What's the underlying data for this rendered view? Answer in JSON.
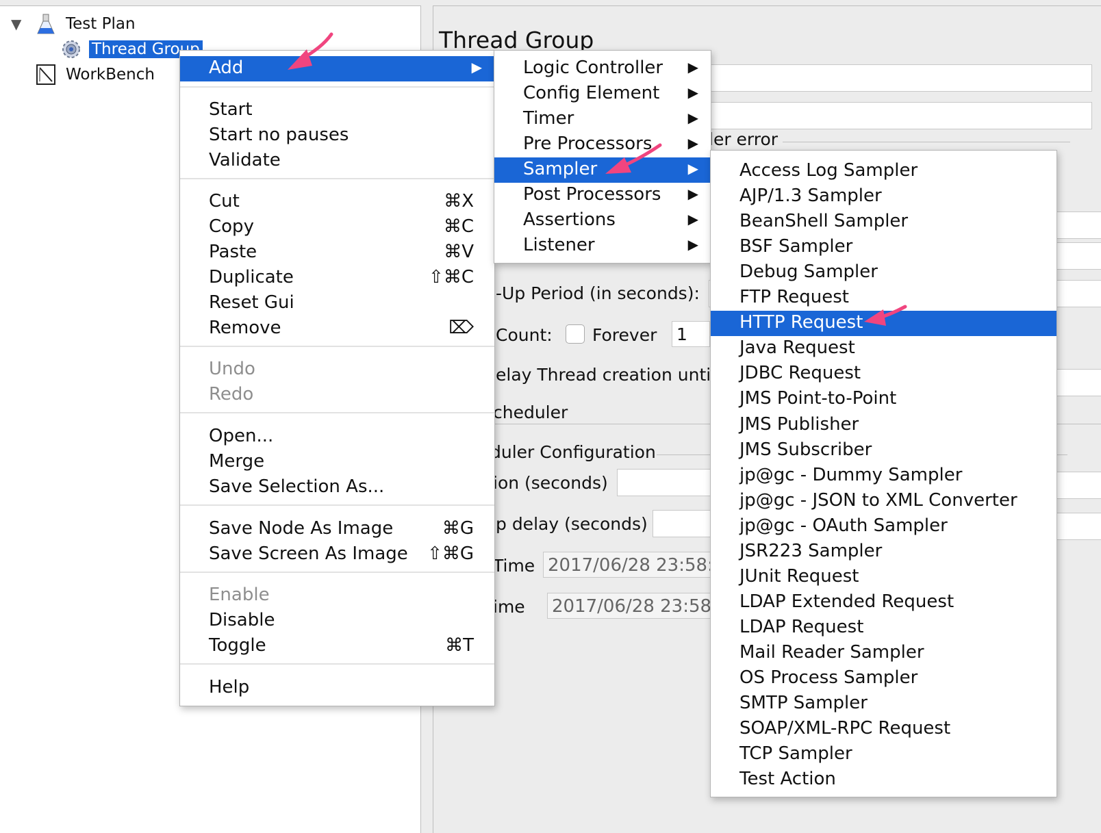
{
  "tree": {
    "items": [
      {
        "label": "Test Plan",
        "icon": "flask-icon"
      },
      {
        "label": "Thread Group",
        "icon": "gear-icon"
      },
      {
        "label": "WorkBench",
        "icon": "workbench-icon"
      }
    ]
  },
  "editor": {
    "title": "Thread Group",
    "fragments": {
      "sampler_error": "ler error",
      "rampup": "-Up Period (in seconds):",
      "loop_count": "Count:",
      "forever": "Forever",
      "loop_value": "1",
      "delay_thread": "elay Thread creation until",
      "scheduler": "cheduler",
      "scheduler_config": "duler Configuration",
      "duration": "ion (seconds)",
      "startup_delay": "p delay (seconds)",
      "start_time_label": "Time",
      "start_time_value": "2017/06/28 23:58:",
      "end_time_label": "ime",
      "end_time_value": "2017/06/28 23:58:"
    }
  },
  "context_menu": {
    "add": "Add",
    "start": "Start",
    "start_no_pauses": "Start no pauses",
    "validate": "Validate",
    "cut": "Cut",
    "cut_sc": "⌘X",
    "copy": "Copy",
    "copy_sc": "⌘C",
    "paste": "Paste",
    "paste_sc": "⌘V",
    "duplicate": "Duplicate",
    "duplicate_sc": "⇧⌘C",
    "reset_gui": "Reset Gui",
    "remove": "Remove",
    "remove_sc": "⌦",
    "undo": "Undo",
    "redo": "Redo",
    "open": "Open...",
    "merge": "Merge",
    "save_selection": "Save Selection As...",
    "save_node_image": "Save Node As Image",
    "save_node_image_sc": "⌘G",
    "save_screen_image": "Save Screen As Image",
    "save_screen_image_sc": "⇧⌘G",
    "enable": "Enable",
    "disable": "Disable",
    "toggle": "Toggle",
    "toggle_sc": "⌘T",
    "help": "Help"
  },
  "add_menu": {
    "items": [
      "Logic Controller",
      "Config Element",
      "Timer",
      "Pre Processors",
      "Sampler",
      "Post Processors",
      "Assertions",
      "Listener"
    ],
    "selected": "Sampler"
  },
  "sampler_menu": {
    "items": [
      "Access Log Sampler",
      "AJP/1.3 Sampler",
      "BeanShell Sampler",
      "BSF Sampler",
      "Debug Sampler",
      "FTP Request",
      "HTTP Request",
      "Java Request",
      "JDBC Request",
      "JMS Point-to-Point",
      "JMS Publisher",
      "JMS Subscriber",
      "jp@gc - Dummy Sampler",
      "jp@gc - JSON to XML Converter",
      "jp@gc - OAuth Sampler",
      "JSR223 Sampler",
      "JUnit Request",
      "LDAP Extended Request",
      "LDAP Request",
      "Mail Reader Sampler",
      "OS Process Sampler",
      "SMTP Sampler",
      "SOAP/XML-RPC Request",
      "TCP Sampler",
      "Test Action"
    ],
    "selected": "HTTP Request"
  },
  "colors": {
    "highlight": "#1a66d6",
    "pointer": "#f0457f"
  }
}
